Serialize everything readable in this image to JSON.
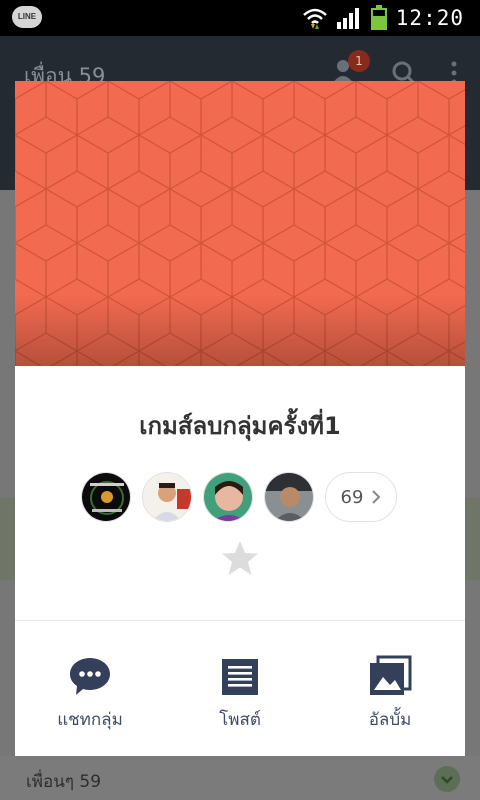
{
  "statusbar": {
    "app_badge": "LINE",
    "time": "12:20"
  },
  "appbar": {
    "title": "เพื่อน 59",
    "notification_count": "1"
  },
  "background_list": {
    "friends_header": "เพื่อนๆ 59"
  },
  "modal": {
    "group_name": "เกมส์ลบกลุ่มครั้งที่1",
    "member_count": "69",
    "cover_color": "#f26a4f",
    "actions": [
      {
        "label": "แชทกลุ่ม",
        "icon": "chat-bubble-icon"
      },
      {
        "label": "โพสต์",
        "icon": "post-list-icon"
      },
      {
        "label": "อัลบั้ม",
        "icon": "album-icon"
      }
    ],
    "accent_color": "#34405a"
  }
}
